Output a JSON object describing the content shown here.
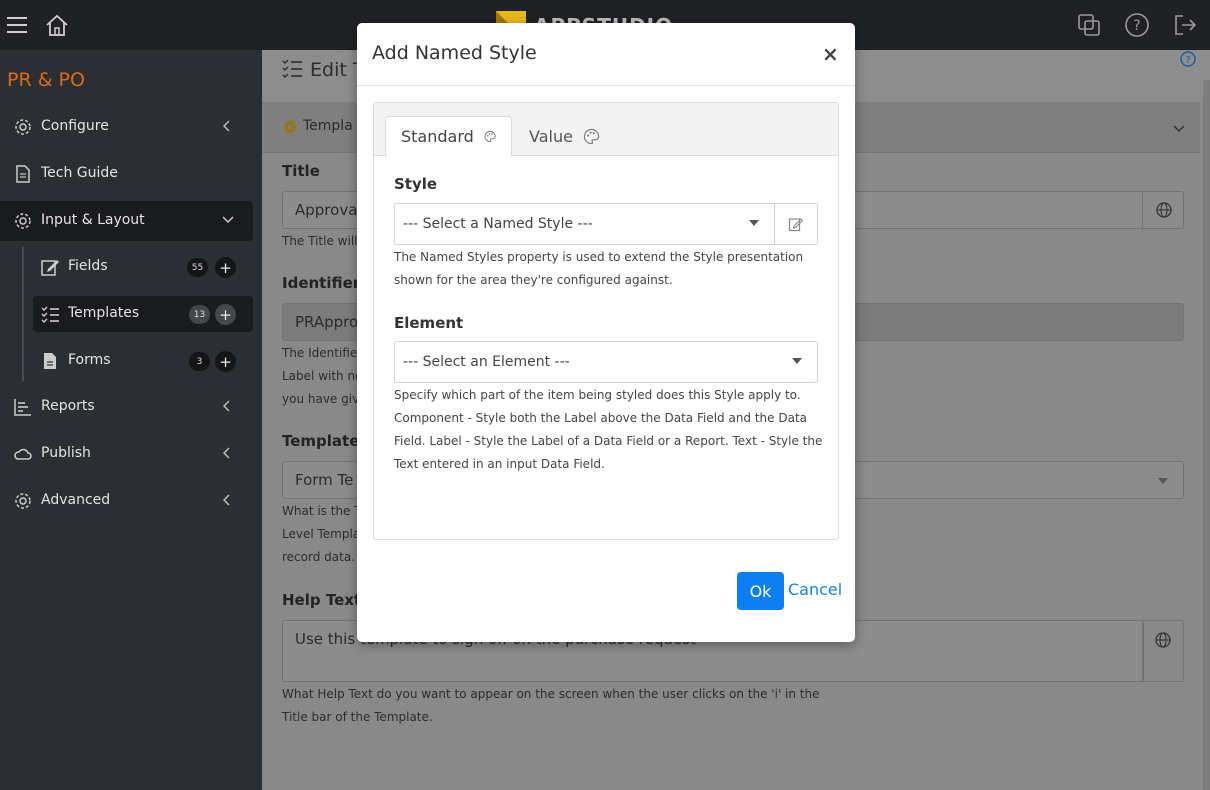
{
  "app": {
    "brand": "APPSTUDIO",
    "project_title": "PR & PO"
  },
  "sidebar": {
    "items": [
      {
        "label": "Configure"
      },
      {
        "label": "Tech Guide"
      },
      {
        "label": "Input & Layout"
      },
      {
        "label": "Reports"
      },
      {
        "label": "Publish"
      },
      {
        "label": "Advanced"
      }
    ],
    "sub_items": [
      {
        "label": "Fields",
        "count": "55"
      },
      {
        "label": "Templates",
        "count": "13"
      },
      {
        "label": "Forms",
        "count": "3"
      }
    ]
  },
  "page": {
    "title": "Edit T",
    "card_title": "Templa",
    "fields": [
      {
        "label": "Title",
        "value": "Approva",
        "hint": "The Title will"
      },
      {
        "label": "Identifier",
        "value": "PRAppro",
        "hint_lines": [
          "The Identifie",
          "Label with no",
          "you have giv"
        ]
      },
      {
        "label": "Template",
        "value": "Form Te",
        "hint_lines": [
          "What is the T",
          "Level Templa",
          "record data."
        ]
      },
      {
        "label": "Help Text",
        "value": "Use this template to sign off on the purchase request",
        "hint_lines": [
          "What Help Text do you want to appear on the screen when the user clicks on the 'i' in the",
          "Title bar of the Template."
        ]
      }
    ]
  },
  "modal": {
    "title": "Add Named Style",
    "close": "×",
    "tabs": [
      {
        "label": "Standard",
        "icon": "palette-icon"
      },
      {
        "label": "Value",
        "icon": "palette-icon"
      }
    ],
    "style": {
      "label": "Style",
      "select_value": "--- Select a Named Style ---",
      "hint_lines": [
        "The Named Styles property is used to extend the Style presentation",
        "shown for the area they're configured against."
      ]
    },
    "element": {
      "label": "Element",
      "select_value": "--- Select an Element ---",
      "hint_lines": [
        "Specify which part of the item being styled does this Style apply to.",
        "Component - Style both the Label above the Data Field and the Data",
        "Field. Label - Style the Label of a Data Field or a Report. Text - Style the",
        "Text entered in an input Data Field."
      ]
    },
    "ok_label": "Ok",
    "cancel_label": "Cancel"
  },
  "colors": {
    "accent": "#0d7ff0",
    "brand_orange": "#e06a16",
    "sidebar_bg": "#2b2e32",
    "topbar_bg": "#1f2124"
  }
}
